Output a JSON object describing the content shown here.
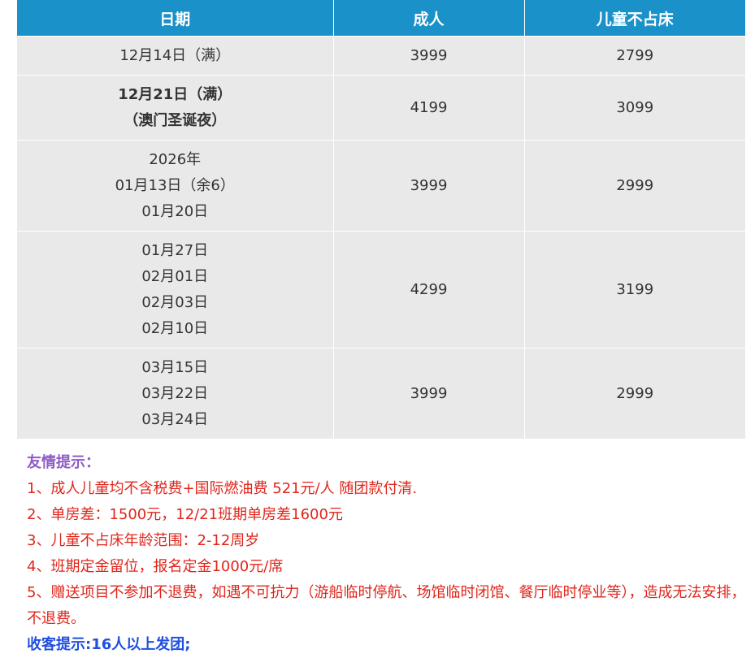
{
  "table": {
    "headers": [
      "日期",
      "成人",
      "儿童不占床"
    ],
    "rows": [
      {
        "dates": [
          "12月14日（满）"
        ],
        "bold": false,
        "adult": "3999",
        "child": "2799"
      },
      {
        "dates": [
          "12月21日（满）",
          "（澳门圣诞夜）"
        ],
        "bold": true,
        "adult": "4199",
        "child": "3099"
      },
      {
        "dates": [
          "2026年",
          "01月13日（余6）",
          "01月20日"
        ],
        "bold": false,
        "adult": "3999",
        "child": "2999"
      },
      {
        "dates": [
          "01月27日",
          "02月01日",
          "02月03日",
          "02月10日"
        ],
        "bold": false,
        "adult": "4299",
        "child": "3199"
      },
      {
        "dates": [
          "03月15日",
          "03月22日",
          "03月24日"
        ],
        "bold": false,
        "adult": "3999",
        "child": "2999"
      }
    ]
  },
  "notes": {
    "title": "友情提示：",
    "items": [
      "1、成人儿童均不含税费+国际燃油费 521元/人  随团款付清.",
      "2、单房差：1500元，12/21班期单房差1600元",
      "3、儿童不占床年龄范围：2-12周岁",
      "4、班期定金留位，报名定金1000元/席",
      "5、赠送项目不参加不退费，如遇不可抗力（游船临时停航、场馆临时闭馆、餐厅临时停业等），造成无法安排，不退费。"
    ],
    "group_tip": "收客提示:16人以上发团;"
  },
  "colors": {
    "header_bg": "#1a91c9",
    "cell_bg": "#e9e9e9",
    "tip_title": "#8e5cc7",
    "note_text": "#e0251b",
    "group_tip": "#1f4fe0"
  }
}
